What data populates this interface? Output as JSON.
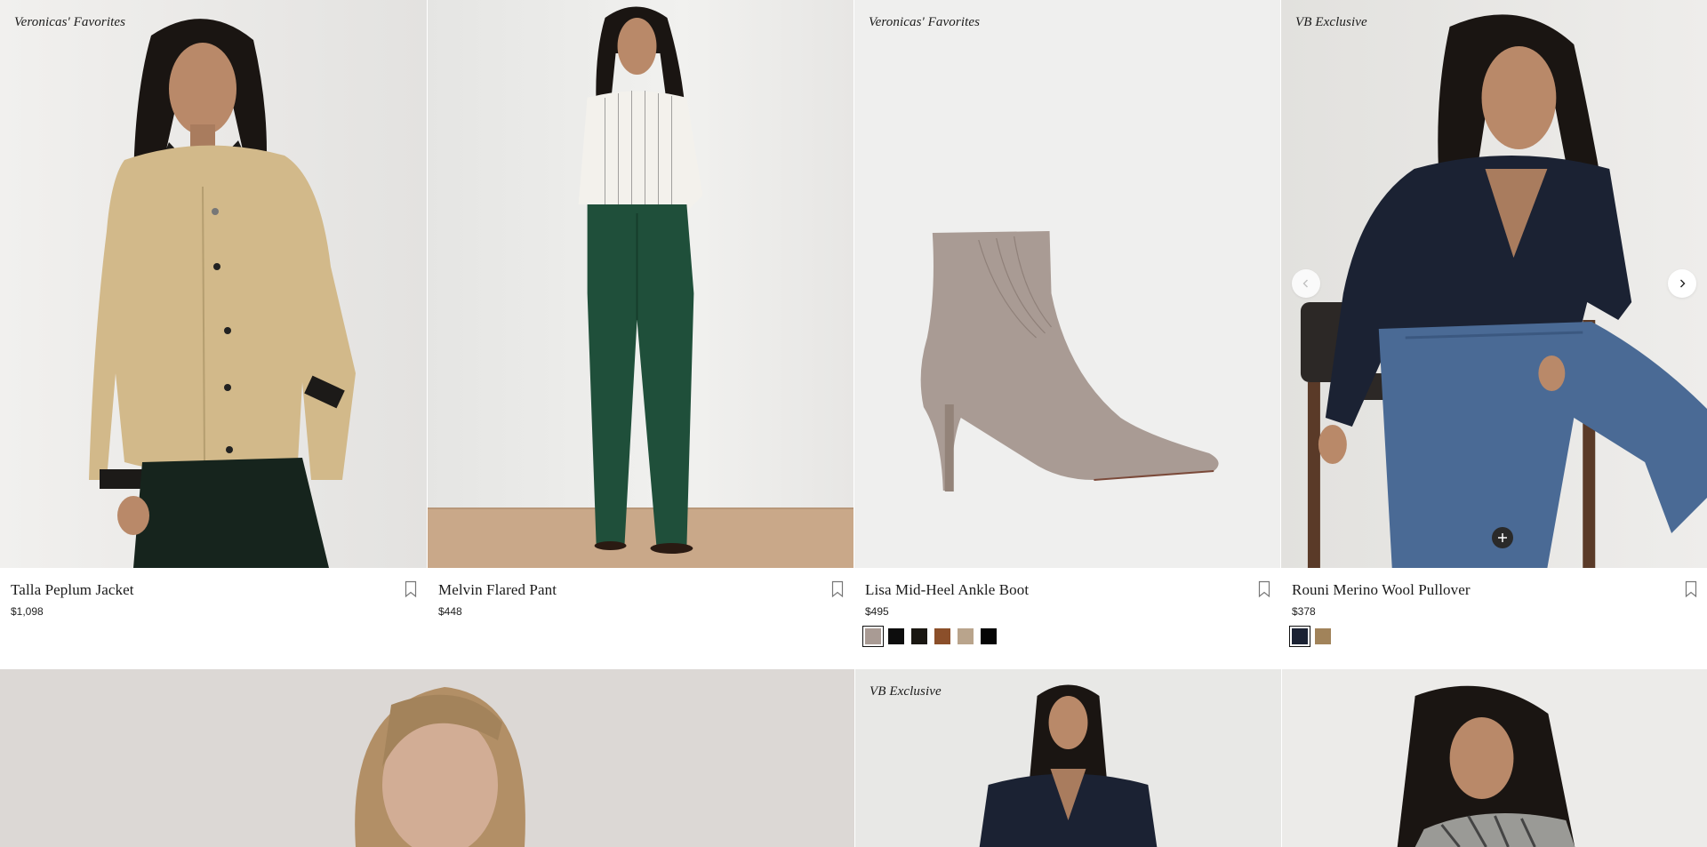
{
  "products_row1": [
    {
      "badge": "Veronicas' Favorites",
      "name": "Talla Peplum Jacket",
      "price": "$1,098",
      "icon": "bookmark-icon",
      "swatches": []
    },
    {
      "badge": "",
      "name": "Melvin Flared Pant",
      "price": "$448",
      "icon": "bookmark-icon",
      "swatches": []
    },
    {
      "badge": "Veronicas' Favorites",
      "name": "Lisa Mid-Heel Ankle Boot",
      "price": "$495",
      "icon": "bookmark-icon",
      "swatches": [
        "#a99b94",
        "#0d0d0d",
        "#1a1712",
        "#8b4f2a",
        "#b9a48c",
        "#050505"
      ]
    },
    {
      "badge": "VB Exclusive",
      "name": "Rouni Merino Wool Pullover",
      "price": "$378",
      "icon": "bookmark-icon",
      "swatches": [
        "#1b2233",
        "#a1835a"
      ]
    }
  ],
  "products_row2": [
    {
      "badge": ""
    },
    {
      "badge": "VB Exclusive"
    },
    {
      "badge": ""
    }
  ],
  "carousel": {
    "prev_icon": "chevron-left-icon",
    "next_icon": "chevron-right-icon",
    "quick_add_icon": "plus-icon"
  },
  "colors": {
    "photo_bg": "#ecebe9",
    "jacket": "#d2b98a",
    "pant": "#1f4f3a",
    "boot": "#a99b94",
    "pullover": "#1b2233",
    "jeans": "#4a6a95"
  }
}
